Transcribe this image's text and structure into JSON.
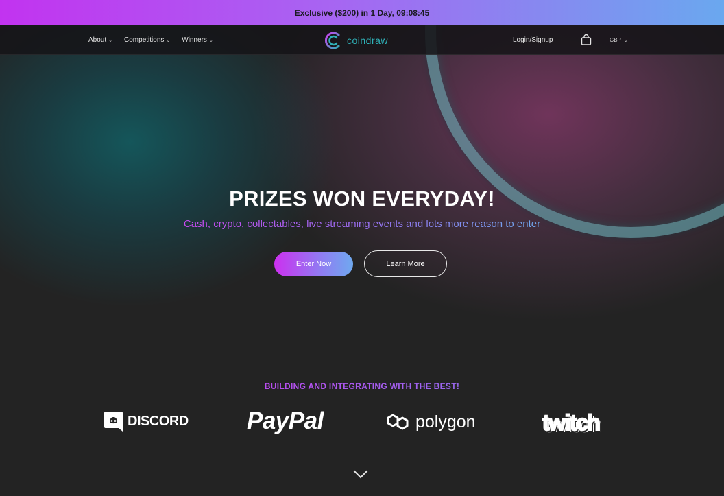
{
  "promo": {
    "text": "Exclusive ($200) in 1 Day, 09:08:45"
  },
  "nav": {
    "items": [
      {
        "label": "About",
        "icon": "chevron-down-icon"
      },
      {
        "label": "Competitions",
        "icon": "chevron-down-icon"
      },
      {
        "label": "Winners",
        "icon": "chevron-down-icon"
      }
    ],
    "logo_text": "coindraw",
    "login_label": "Login/Signup",
    "cart_icon": "shopping-bag-icon",
    "currency": "GBP"
  },
  "hero": {
    "title": "PRIZES WON EVERYDAY!",
    "subtitle": "Cash, crypto, collectables, live streaming events and lots more reason to enter",
    "primary_button": "Enter Now",
    "secondary_button": "Learn More"
  },
  "partners": {
    "heading": "BUILDING AND INTEGRATING WITH THE BEST!",
    "logos": [
      {
        "name": "DISCORD",
        "icon": "discord-icon"
      },
      {
        "name": "PayPal"
      },
      {
        "name": "polygon",
        "icon": "polygon-icon"
      },
      {
        "name": "twitch"
      }
    ]
  },
  "scroll_icon": "chevron-down-icon",
  "colors": {
    "accent_purple": "#c233f0",
    "accent_blue": "#6aa8ef",
    "logo_teal": "#2fb2b8",
    "background": "#232323"
  }
}
